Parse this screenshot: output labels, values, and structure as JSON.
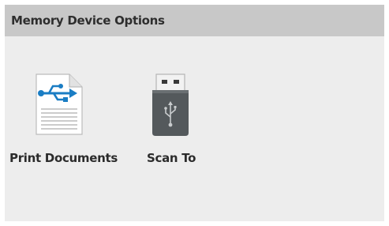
{
  "header": {
    "title": "Memory Device Options"
  },
  "tiles": [
    {
      "label": "Print Documents",
      "icon": "usb-document-icon"
    },
    {
      "label": "Scan To",
      "icon": "usb-drive-icon"
    }
  ],
  "colors": {
    "title_bar": "#c8c8c8",
    "background": "#ededed",
    "usb_accent": "#1a7dc4",
    "drive_body": "#54595c"
  }
}
